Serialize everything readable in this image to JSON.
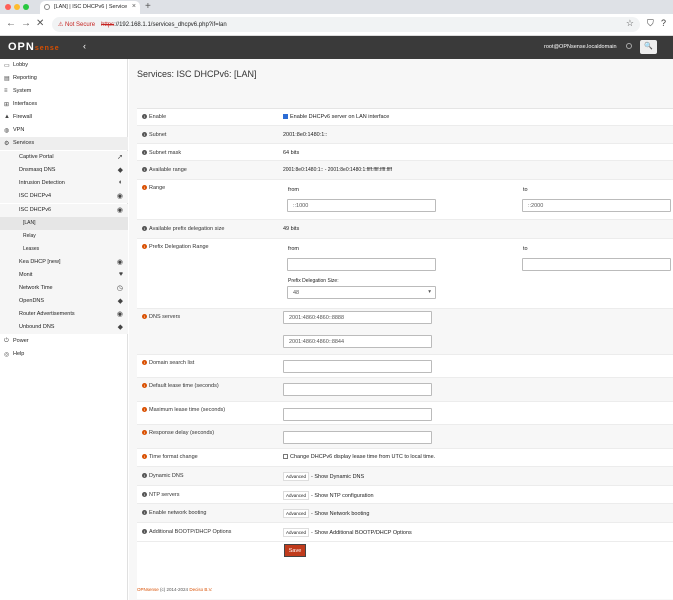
{
  "browser": {
    "tab_title": "[LAN] | ISC DHCPv6 | Service",
    "new_tab": "+",
    "not_secure": "Not Secure",
    "url_scheme": "https",
    "url_rest": "://192.168.1.1/services_dhcpv6.php?if=lan"
  },
  "topbar": {
    "logo": "OPN",
    "logo_suffix": "sense",
    "user": "root@OPNsense.localdomain"
  },
  "sidebar": {
    "items": [
      {
        "label": "Lobby",
        "icon": "laptop-icon"
      },
      {
        "label": "Reporting",
        "icon": "chart-icon"
      },
      {
        "label": "System",
        "icon": "server-icon"
      },
      {
        "label": "Interfaces",
        "icon": "sitemap-icon"
      },
      {
        "label": "Firewall",
        "icon": "fire-icon"
      },
      {
        "label": "VPN",
        "icon": "globe-icon"
      },
      {
        "label": "Services",
        "icon": "cog-icon"
      },
      {
        "label": "Captive Portal"
      },
      {
        "label": "Dnsmasq DNS"
      },
      {
        "label": "Intrusion Detection"
      },
      {
        "label": "ISC DHCPv4"
      },
      {
        "label": "ISC DHCPv6"
      },
      {
        "label": "[LAN]"
      },
      {
        "label": "Relay"
      },
      {
        "label": "Leases"
      },
      {
        "label": "Kea DHCP [new]"
      },
      {
        "label": "Monit"
      },
      {
        "label": "Network Time"
      },
      {
        "label": "OpenDNS"
      },
      {
        "label": "Router Advertisements"
      },
      {
        "label": "Unbound DNS"
      },
      {
        "label": "Power",
        "icon": "plug-icon"
      },
      {
        "label": "Help",
        "icon": "lifebuoy-icon"
      }
    ]
  },
  "page": {
    "title": "Services: ISC DHCPv6: [LAN]"
  },
  "form": {
    "enable": {
      "label": "Enable",
      "text": "Enable DHCPv6 server on LAN interface"
    },
    "subnet": {
      "label": "Subnet",
      "value": "2001:8e0:1480:1::"
    },
    "subnet_mask": {
      "label": "Subnet mask",
      "value": "64 bits"
    },
    "available_range": {
      "label": "Available range",
      "value": "2001:8e0:1480:1:: - 2001:8e0:1480:1:ffff:ffff:ffff:ffff"
    },
    "range": {
      "label": "Range",
      "from_label": "from",
      "to_label": "to",
      "from_value": "::1000",
      "to_value": "::2000"
    },
    "prefix_size": {
      "label": "Available prefix delegation size",
      "value": "49 bits"
    },
    "pd_range": {
      "label": "Prefix Delegation Range",
      "from_label": "from",
      "to_label": "to",
      "size_label": "Prefix Delegation Size:",
      "size_value": "48"
    },
    "dns": {
      "label": "DNS servers",
      "server1": "2001:4860:4860::8888",
      "server2": "2001:4860:4860::8844"
    },
    "domain_search": {
      "label": "Domain search list"
    },
    "default_lease": {
      "label": "Default lease time (seconds)"
    },
    "max_lease": {
      "label": "Maximum lease time (seconds)"
    },
    "response_delay": {
      "label": "Response delay (seconds)"
    },
    "time_format": {
      "label": "Time format change",
      "text": "Change DHCPv6 display lease time from UTC to local time."
    },
    "dyn_dns": {
      "label": "Dynamic DNS",
      "btn": "Advanced",
      "text": "- Show Dynamic DNS"
    },
    "ntp": {
      "label": "NTP servers",
      "btn": "Advanced",
      "text": "- Show NTP configuration"
    },
    "netboot": {
      "label": "Enable network booting",
      "btn": "Advanced",
      "text": "- Show Network booting"
    },
    "bootp": {
      "label": "Additional BOOTP/DHCP Options",
      "btn": "Advanced",
      "text": "- Show Additional BOOTP/DHCP Options"
    },
    "save": "Save"
  },
  "footer": {
    "brand": "OPNsense",
    "text": "(c) 2014-2024",
    "link": "Deciso B.V."
  }
}
